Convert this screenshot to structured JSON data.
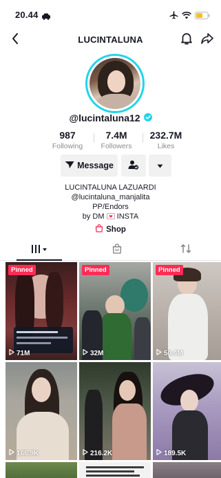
{
  "status_bar": {
    "time": "20.44"
  },
  "header": {
    "title": "LUCINTALUNA"
  },
  "profile": {
    "handle": "@lucintaluna12",
    "verified": true,
    "stats": [
      {
        "value": "987",
        "label": "Following"
      },
      {
        "value": "7.4M",
        "label": "Followers"
      },
      {
        "value": "232.7M",
        "label": "Likes"
      }
    ],
    "message_button": "Message",
    "bio_lines": [
      "LUCINTALUNA LAZUARDI",
      "@lucintaluna_manjalita",
      "PP/Endors"
    ],
    "bio_dm_prefix": "by DM",
    "bio_dm_suffix": "INSTA",
    "shop_label": "Shop"
  },
  "tabs": [
    "videos-grid-icon",
    "bag-icon",
    "repost-icon"
  ],
  "videos": [
    {
      "pinned": "Pinned",
      "views": "71M"
    },
    {
      "pinned": "Pinned",
      "views": "32M"
    },
    {
      "pinned": "Pinned",
      "views": "50.4M"
    },
    {
      "views": "166.9K"
    },
    {
      "views": "216.2K"
    },
    {
      "views": "189.5K"
    }
  ],
  "colors": {
    "accent": "#fe2c55",
    "verified": "#20d5ec",
    "button_bg": "#f1f1f2"
  }
}
